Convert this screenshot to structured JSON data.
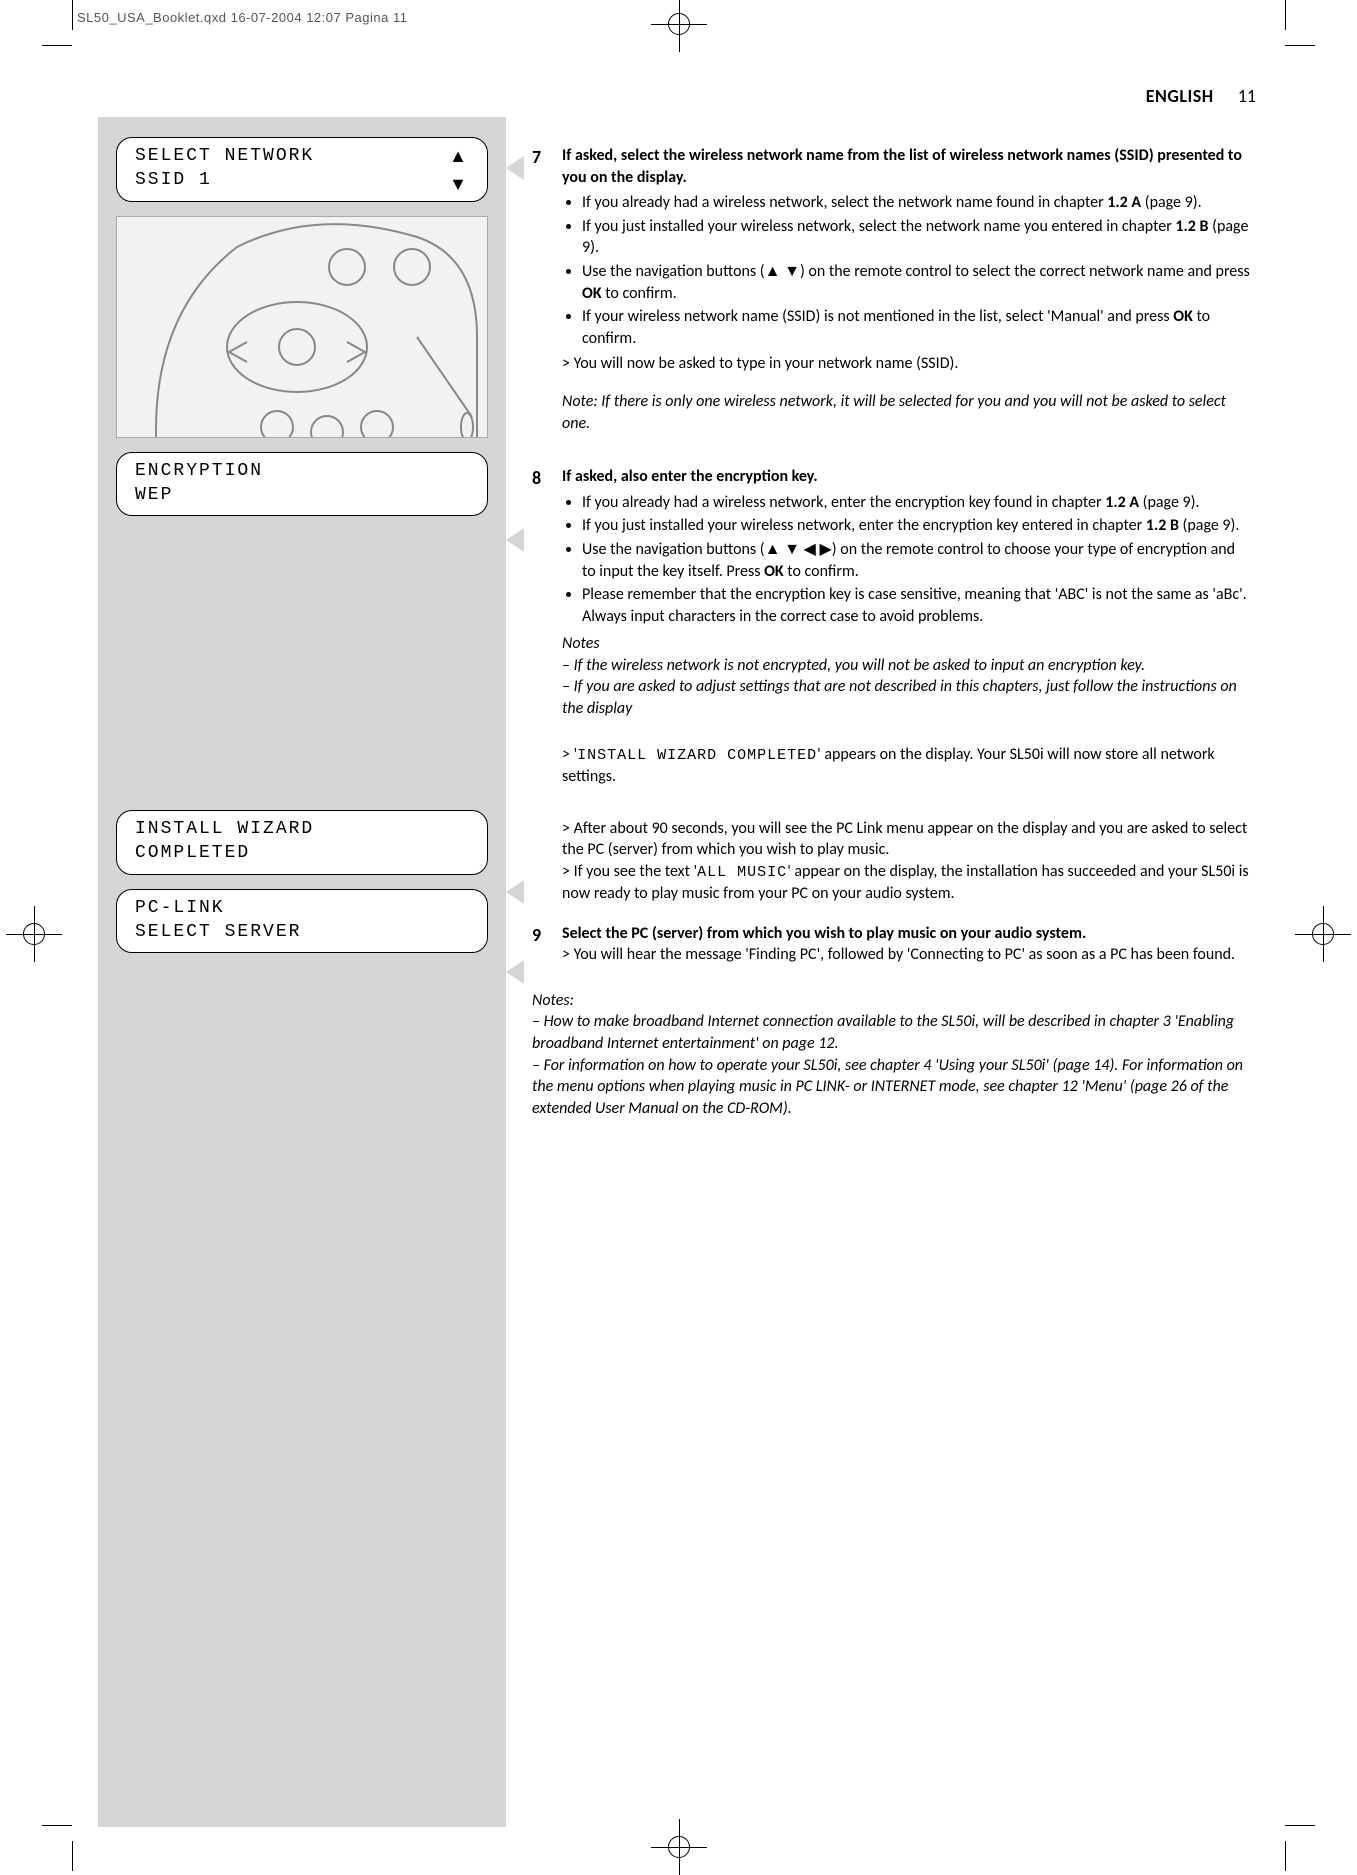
{
  "slugline": "SL50_USA_Booklet.qxd  16-07-2004  12:07  Pagina 11",
  "header": {
    "lang": "ENGLISH",
    "page": "11"
  },
  "lcd": {
    "network": {
      "l1": "SELECT NETWORK",
      "l2": " SSID 1",
      "up": "▲",
      "down": "▼"
    },
    "encryption": {
      "l1": "ENCRYPTION",
      "l2": " WEP"
    },
    "wizard": {
      "l1": "INSTALL WIZARD",
      "l2": " COMPLETED"
    },
    "pclink": {
      "l1": " PC-LINK",
      "l2": " SELECT SERVER"
    }
  },
  "step7": {
    "num": "7",
    "lead": "If asked, select the wireless network name from the list of wireless network names (SSID) presented to you on the display.",
    "b1a": "If you already had a wireless network, select the network name found in chapter ",
    "b1b": "1.2 A",
    "b1c": " (page 9).",
    "b2a": "If you just installed your wireless network, select the network name you entered in chapter ",
    "b2b": "1.2 B",
    "b2c": " (page 9).",
    "b3a": "Use the navigation buttons (▲ ▼) on the remote control to select the correct network name and press ",
    "b3b": "OK",
    "b3c": " to confirm.",
    "b4a": "If your wireless network name (SSID) is not mentioned in the list, select 'Manual' and press ",
    "b4b": "OK",
    "b4c": " to confirm.",
    "gt": "> You will now be asked to type in your network name (SSID).",
    "note": "Note: If there is only one wireless network, it will be selected for you and you will not be asked to select one."
  },
  "step8": {
    "num": "8",
    "lead": "If asked, also enter the encryption key.",
    "b1a": "If you already had a wireless network, enter the encryption key found in chapter ",
    "b1b": "1.2 A",
    "b1c": " (page 9).",
    "b2a": "If you just installed your wireless network, enter the encryption key entered in chapter ",
    "b2b": "1.2 B",
    "b2c": " (page 9).",
    "b3a": "Use the navigation buttons (▲ ▼ ◀ ▶) on the remote control to choose your type of encryption and to input the key itself. Press ",
    "b3b": "OK",
    "b3c": " to confirm.",
    "b4": "Please remember that the encryption key is case sensitive, meaning that 'ABC' is not the same as 'aBc'. Always input characters in the correct case to avoid problems.",
    "notes_h": "Notes",
    "n1": "– If the wireless network is not encrypted, you will not be asked to input an encryption key.",
    "n2": "– If you are asked to adjust settings that are not described in this chapters, just follow the instructions on the display",
    "gt1a": "> '",
    "gt1b": "INSTALL WIZARD COMPLETED",
    "gt1c": "' appears on the display. Your SL50i will now store all network settings.",
    "gt2": "> After about 90 seconds, you will see the PC Link menu appear on the display and you are asked to select the PC (server) from which you wish to play music.",
    "gt3a": "> If you see the text '",
    "gt3b": "ALL MUSIC",
    "gt3c": "' appear on the display, the installation has succeeded and your SL50i is now ready to play music from your PC on your audio system."
  },
  "step9": {
    "num": "9",
    "lead": "Select the PC (server) from which you wish to play music on your audio system.",
    "gt": "> You will hear the message 'Finding PC', followed by 'Connecting to PC' as soon as a PC has been found."
  },
  "footnotes": {
    "h": "Notes:",
    "n1": "– How to make broadband Internet connection available to the SL50i, will be described in chapter 3 'Enabling broadband Internet entertainment' on page 12.",
    "n2": "– For information on how to operate your SL50i, see chapter 4 'Using your SL50i' (page 14). For information on the menu options when playing music in PC LINK- or INTERNET mode, see chapter 12 'Menu' (page 26 of the extended User Manual on the CD-ROM)."
  }
}
